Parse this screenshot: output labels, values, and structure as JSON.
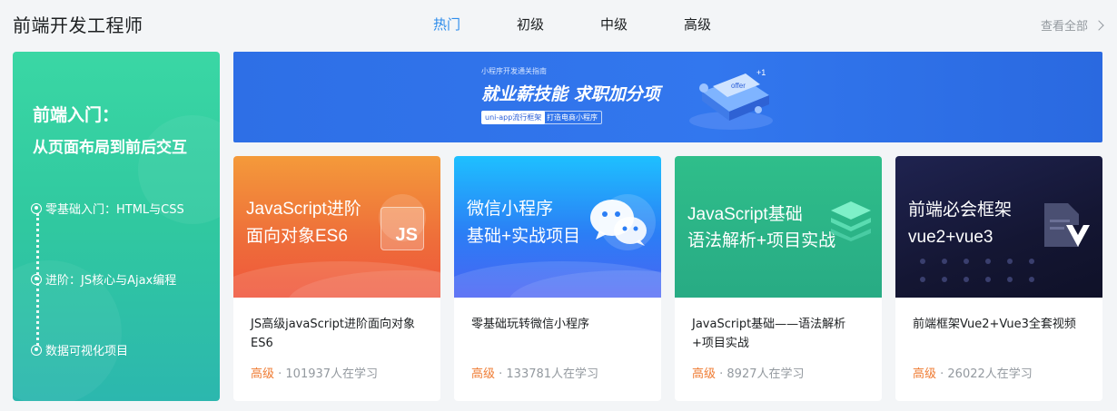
{
  "header": {
    "title": "前端开发工程师",
    "tabs": [
      {
        "label": "热门",
        "active": true
      },
      {
        "label": "初级",
        "active": false
      },
      {
        "label": "中级",
        "active": false
      },
      {
        "label": "高级",
        "active": false
      }
    ],
    "view_all": "查看全部"
  },
  "sidebar": {
    "title": "前端入门：",
    "subtitle": "从页面布局到前后交互",
    "items": [
      "零基础入门：HTML与CSS",
      "进阶：JS核心与Ajax编程",
      "数据可视化项目"
    ]
  },
  "banner": {
    "kicker": "小程序开发通关指南",
    "headline": "就业薪技能 求职加分项",
    "tag_primary": "uni-app流行框架",
    "tag_secondary": "打造电商小程序",
    "art_badge": "offer"
  },
  "cards": [
    {
      "cover_line1": "JavaScript进阶",
      "cover_line2": "面向对象ES6",
      "badge": "JS",
      "name": "JS高级javaScript进阶面向对象ES6",
      "level": "高级",
      "learners": " · 101937人在学习"
    },
    {
      "cover_line1": "微信小程序",
      "cover_line2": "基础+实战项目",
      "name": "零基础玩转微信小程序",
      "level": "高级",
      "learners": " · 133781人在学习"
    },
    {
      "cover_line1": "JavaScript基础",
      "cover_line2": "语法解析+项目实战",
      "name": "JavaScript基础——语法解析+项目实战",
      "level": "高级",
      "learners": " · 8927人在学习"
    },
    {
      "cover_line1": "前端必会框架",
      "cover_line2": "vue2+vue3",
      "name": "前端框架Vue2+Vue3全套视频",
      "level": "高级",
      "learners": " · 26022人在学习"
    }
  ],
  "colors": {
    "accent": "#2d8ceb",
    "level": "#ef7b32",
    "muted": "#93999f"
  }
}
